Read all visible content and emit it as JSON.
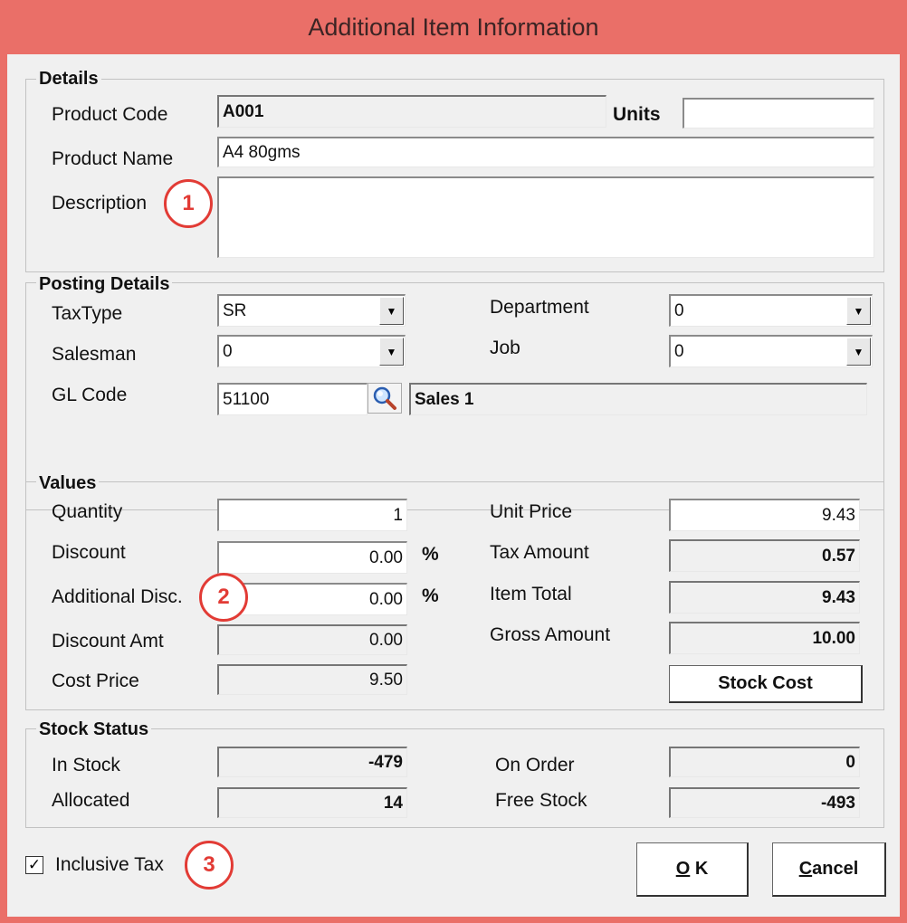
{
  "window": {
    "title": "Additional Item Information"
  },
  "details": {
    "legend": "Details",
    "product_code_label": "Product Code",
    "product_code": "A001",
    "units_label": "Units",
    "units": "",
    "product_name_label": "Product Name",
    "product_name": "A4 80gms",
    "description_label": "Description",
    "description": ""
  },
  "posting": {
    "legend": "Posting Details",
    "taxtype_label": "TaxType",
    "taxtype": "SR",
    "salesman_label": "Salesman",
    "salesman": "0",
    "glcode_label": "GL Code",
    "glcode": "51100",
    "gl_name": "Sales 1",
    "department_label": "Department",
    "department": "0",
    "job_label": "Job",
    "job": "0"
  },
  "values": {
    "legend": "Values",
    "quantity_label": "Quantity",
    "quantity": "1",
    "discount_label": "Discount",
    "discount": "0.00",
    "additional_disc_label": "Additional Disc.",
    "additional_disc": "0.00",
    "percent": "%",
    "discount_amt_label": "Discount Amt",
    "discount_amt": "0.00",
    "cost_price_label": "Cost Price",
    "cost_price": "9.50",
    "unit_price_label": "Unit Price",
    "unit_price": "9.43",
    "tax_amount_label": "Tax Amount",
    "tax_amount": "0.57",
    "item_total_label": "Item Total",
    "item_total": "9.43",
    "gross_amount_label": "Gross Amount",
    "gross_amount": "10.00",
    "stock_cost_button": "Stock Cost"
  },
  "stock": {
    "legend": "Stock Status",
    "in_stock_label": "In Stock",
    "in_stock": "-479",
    "allocated_label": "Allocated",
    "allocated": "14",
    "on_order_label": "On Order",
    "on_order": "0",
    "free_stock_label": "Free Stock",
    "free_stock": "-493"
  },
  "footer": {
    "inclusive_tax_label": "Inclusive Tax",
    "inclusive_tax_checked": true,
    "check_mark": "✓",
    "ok_mnemonic": "O",
    "ok_rest": " K",
    "cancel_mnemonic": "C",
    "cancel_rest": "ancel"
  },
  "annotations": {
    "one": "1",
    "two": "2",
    "three": "3"
  },
  "colors": {
    "frame": "#ea6f68",
    "annotation": "#e23b35",
    "dialog_bg": "#f0f0f0"
  },
  "icons": {
    "lookup": "magnifier-icon",
    "dropdown": "dropdown-arrow-icon"
  }
}
